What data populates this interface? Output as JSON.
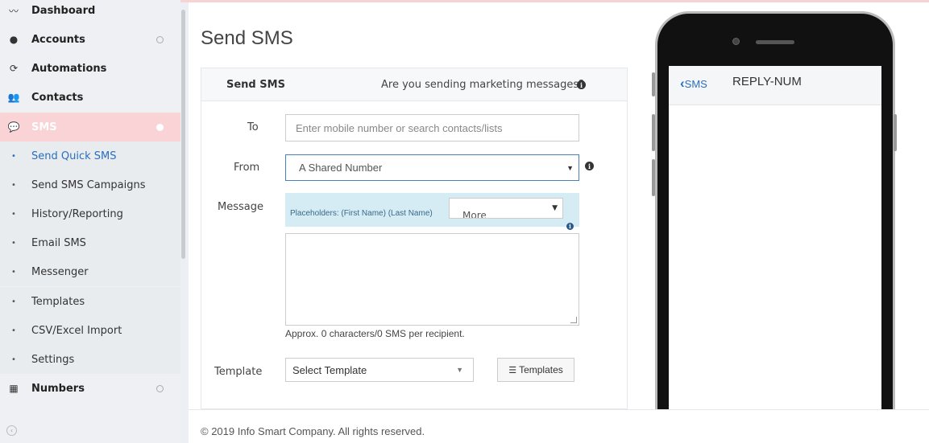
{
  "sidebar": {
    "nav": [
      {
        "label": "Dashboard",
        "icon": "line-chart-icon"
      },
      {
        "label": "Accounts",
        "icon": "user-icon"
      },
      {
        "label": "Automations",
        "icon": "refresh-icon"
      },
      {
        "label": "Contacts",
        "icon": "users-icon"
      },
      {
        "label": "SMS",
        "icon": "chat-bubble-icon"
      }
    ],
    "sms_sub": [
      {
        "label": "Send Quick SMS"
      },
      {
        "label": "Send SMS Campaigns"
      },
      {
        "label": "History/Reporting"
      },
      {
        "label": "Email SMS"
      },
      {
        "label": "Messenger"
      },
      {
        "label": "Templates"
      },
      {
        "label": "CSV/Excel Import"
      },
      {
        "label": "Settings"
      }
    ],
    "numbers": {
      "label": "Numbers",
      "icon": "sim-card-icon"
    }
  },
  "page": {
    "title": "Send SMS",
    "panel_title": "Send SMS",
    "marketing_question": "Are you sending marketing messages?"
  },
  "form": {
    "to_label": "To",
    "to_placeholder": "Enter mobile number or search contacts/lists",
    "from_label": "From",
    "from_value": "A Shared Number",
    "message_label": "Message",
    "placeholders_text": "Placeholders: (First Name) (Last Name)",
    "more_value": "More",
    "approx_text": "Approx. 0 characters/0 SMS per recipient.",
    "template_label": "Template",
    "template_value": "Select Template",
    "templates_button": "Templates"
  },
  "phone": {
    "back_label": "SMS",
    "recipient": "REPLY-NUM"
  },
  "footer": {
    "text": "© 2019 Info Smart Company. All rights reserved."
  },
  "colors": {
    "active_nav_bg": "#f9d3d5",
    "link_blue": "#2a6ebd",
    "placeholder_bar": "#d5ecf5"
  }
}
